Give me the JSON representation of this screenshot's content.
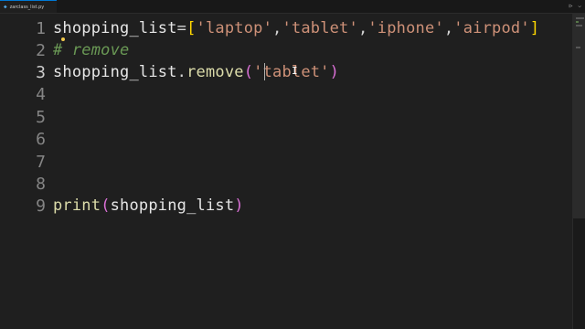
{
  "tab": {
    "label": "zarclass_list.py",
    "icon": "python-file-icon"
  },
  "actions": {
    "run_icon": "▷",
    "more_icon": "⌵"
  },
  "editor": {
    "lines": [
      {
        "number": "1"
      },
      {
        "number": "2"
      },
      {
        "number": "3"
      },
      {
        "number": "4"
      },
      {
        "number": "5"
      },
      {
        "number": "6"
      },
      {
        "number": "7"
      },
      {
        "number": "8"
      },
      {
        "number": "9"
      }
    ],
    "code": {
      "l1": {
        "var": "shopping_list",
        "eq": "=",
        "lbr": "[",
        "s1": "'laptop'",
        "c1": ",",
        "s2": "'tablet'",
        "c2": ",",
        "s3": "'iphone'",
        "c3": ",",
        "s4": "'airpod'",
        "rbr": "]"
      },
      "l2": {
        "comment": "# remove"
      },
      "l3": {
        "var": "shopping_list",
        "dot": ".",
        "method": "remove",
        "lp": "(",
        "s1": "'tablet'",
        "rp": ")"
      },
      "l9": {
        "func": "print",
        "lp": "(",
        "arg": "shopping_list",
        "rp": ")"
      }
    }
  },
  "colors": {
    "background": "#1f1f1f",
    "string": "#ce9178",
    "comment": "#6a9955",
    "bracket": "#ffd700",
    "paren": "#da70d6",
    "function": "#dcdcaa"
  }
}
